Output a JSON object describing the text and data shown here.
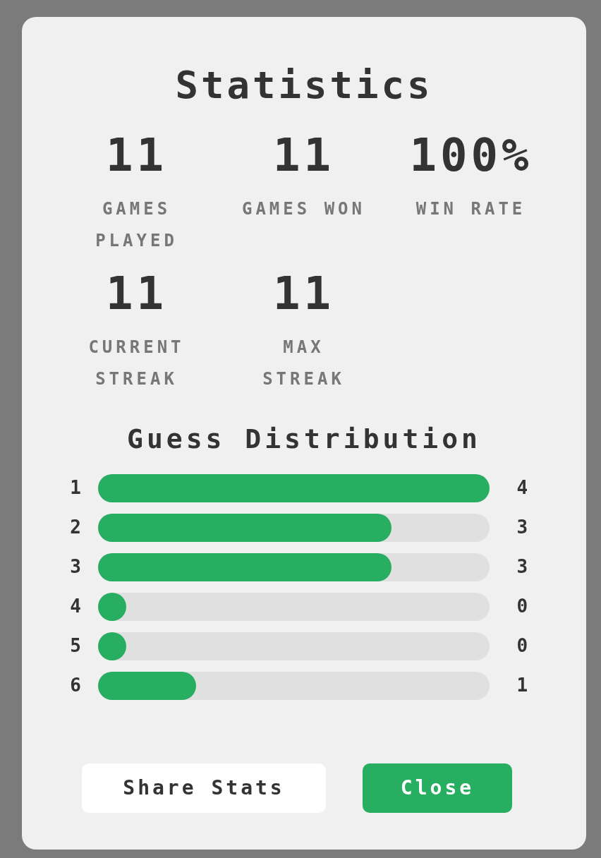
{
  "title": "Statistics",
  "stats": [
    {
      "value": "11",
      "label": "GAMES PLAYED"
    },
    {
      "value": "11",
      "label": "GAMES WON"
    },
    {
      "value": "100%",
      "label": "WIN RATE"
    },
    {
      "value": "11",
      "label": "CURRENT STREAK"
    },
    {
      "value": "11",
      "label": "MAX STREAK"
    }
  ],
  "distribution": {
    "title": "Guess Distribution",
    "rows": [
      {
        "guess": "1",
        "count": "4",
        "level": 1
      },
      {
        "guess": "2",
        "count": "3",
        "level": 0.75
      },
      {
        "guess": "3",
        "count": "3",
        "level": 0.75
      },
      {
        "guess": "4",
        "count": "0",
        "level": 0
      },
      {
        "guess": "5",
        "count": "0",
        "level": 0
      },
      {
        "guess": "6",
        "count": "1",
        "level": 0.25
      }
    ]
  },
  "buttons": [
    {
      "label": "Share Stats",
      "kind": "secondary"
    },
    {
      "label": "Close",
      "kind": "primary"
    }
  ]
}
